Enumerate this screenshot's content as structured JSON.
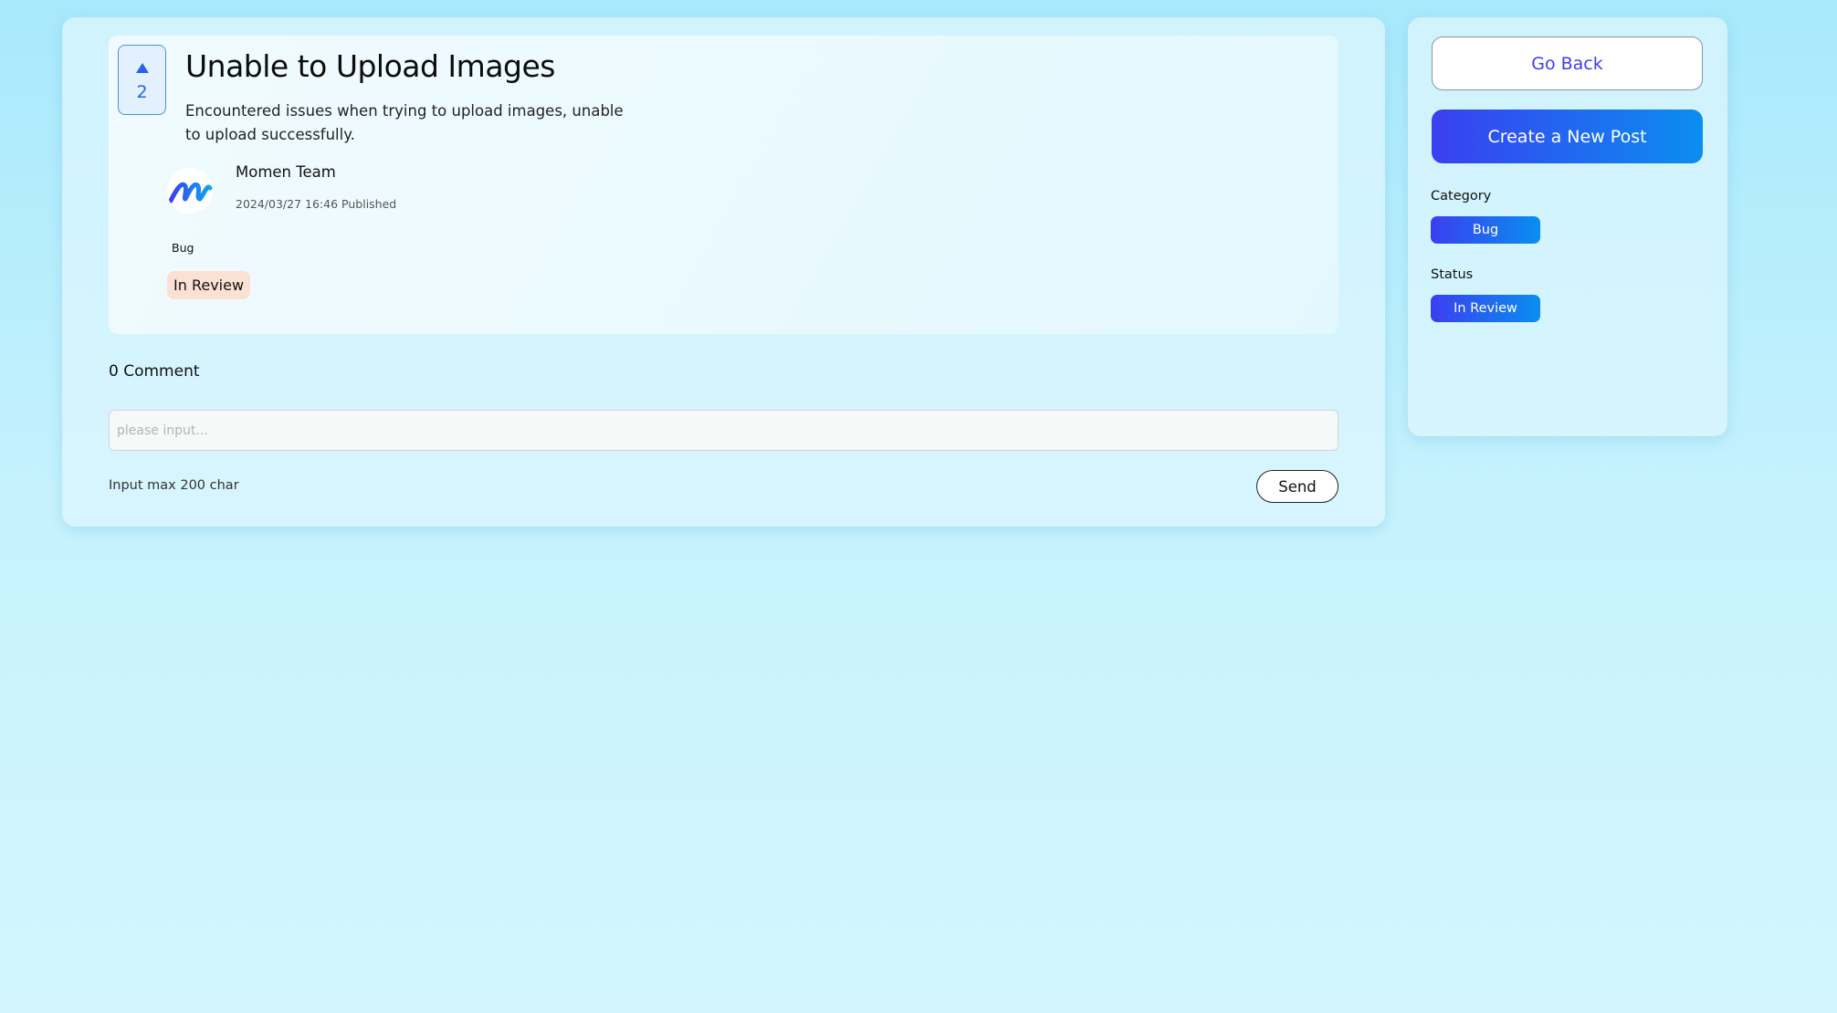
{
  "post": {
    "votes": "2",
    "title": "Unable to Upload Images",
    "description": "Encountered issues when trying to upload images, unable to upload successfully.",
    "author": "Momen Team",
    "date": "2024/03/27 16:46",
    "published_label": "Published",
    "category": "Bug",
    "status": "In Review"
  },
  "comments": {
    "count_label": "0 Comment",
    "placeholder": "please input...",
    "hint": "Input max 200 char",
    "send_label": "Send"
  },
  "sidebar": {
    "go_back_label": "Go Back",
    "create_label": "Create a New Post",
    "category_heading": "Category",
    "category_value": "Bug",
    "status_heading": "Status",
    "status_value": "In Review"
  },
  "colors": {
    "accent": "#3a3ff0",
    "accent_end": "#0a8ef0",
    "status_pill": "#fbe0d4",
    "vote": "#2563eb"
  },
  "icons": {
    "upvote": "triangle-up-icon",
    "avatar_logo": "momen-logo-icon"
  }
}
